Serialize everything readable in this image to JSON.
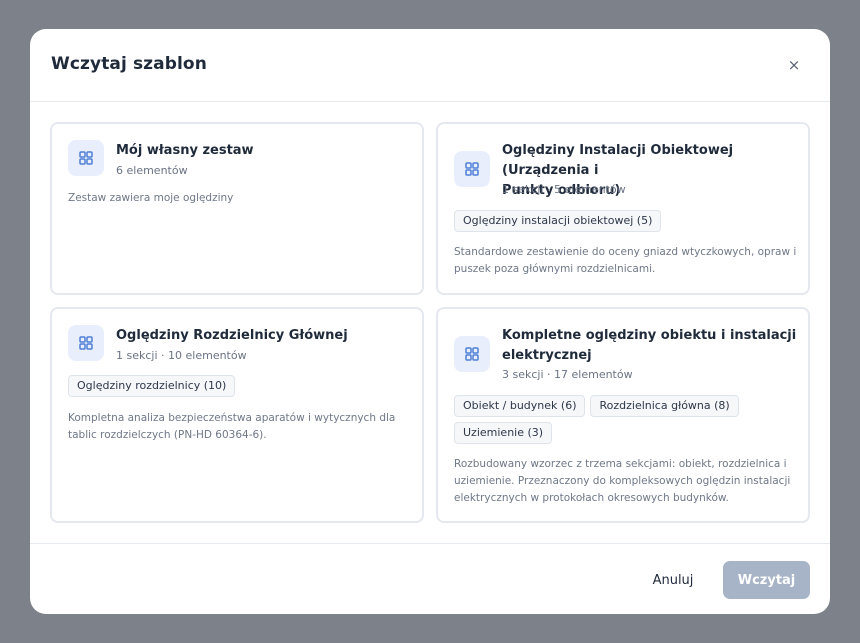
{
  "modal": {
    "title": "Wczytaj szablon",
    "close_label": "×"
  },
  "templates": [
    {
      "title": "Mój własny zestaw",
      "meta": "6 elementów",
      "tags": [],
      "description": "Zestaw zawiera moje oględziny",
      "icon": "grid-icon"
    },
    {
      "title_line1": "Oględziny Instalacji Obiektowej (Urządzenia i",
      "title_line2": "Punkty odbioru)",
      "meta": "1 sekcji · 5 elementów",
      "tags": [
        "Oględziny instalacji obiektowej (5)"
      ],
      "description_line1": "Standardowe zestawienie do oceny gniazd wtyczkowych, opraw i",
      "description_line2": "puszek poza głównymi rozdzielnicami.",
      "icon": "grid-icon"
    },
    {
      "title": "Oględziny Rozdzielnicy Głównej",
      "meta": "1 sekcji · 10 elementów",
      "tags": [
        "Oględziny rozdzielnicy (10)"
      ],
      "description_line1": "Kompletna analiza bezpieczeństwa aparatów i wytycznych dla",
      "description_line2": "tablic rozdzielczych (PN-HD 60364-6).",
      "icon": "grid-icon"
    },
    {
      "title_line1": "Kompletne oględziny obiektu i instalacji",
      "title_line2": "elektrycznej",
      "meta": "3 sekcji · 17 elementów",
      "tags": [
        "Obiekt / budynek (6)",
        "Rozdzielnica główna (8)",
        "Uziemienie (3)"
      ],
      "description_line1": "Rozbudowany wzorzec z trzema sekcjami: obiekt, rozdzielnica i",
      "description_line2": "uziemienie. Przeznaczony do kompleksowych oględzin instalacji",
      "description_line3": "elektrycznych w protokołach okresowych budynków.",
      "icon": "grid-icon"
    }
  ],
  "footer": {
    "cancel_label": "Anuluj",
    "load_label": "Wczytaj"
  },
  "colors": {
    "accent_icon": "#4f7fd6",
    "icon_bg": "#e8eefb",
    "load_button_disabled": "#a7b4c8"
  }
}
